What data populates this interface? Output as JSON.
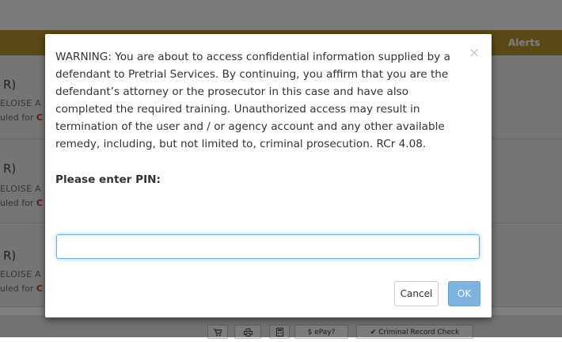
{
  "background": {
    "header": {
      "alerts_label": "Alerts"
    },
    "rows": [
      {
        "paren": "R)",
        "name": "ELOISE A",
        "sched_prefix": "uled for ",
        "sched_flag": "C"
      },
      {
        "paren": "R)",
        "name": "ELOISE A",
        "sched_prefix": "uled for ",
        "sched_flag": "C"
      },
      {
        "paren": "R)",
        "name": "ELOISE A",
        "sched_prefix": "uled for ",
        "sched_flag": "C"
      }
    ],
    "toolbar": {
      "cart_icon": "cart-icon",
      "print_icon": "print-icon",
      "calculator_icon": "calculator-icon",
      "epay_label": "$ ePay?",
      "record_check_label": "✔ Criminal Record Check"
    }
  },
  "dialog": {
    "close_symbol": "×",
    "warning_text": "WARNING: You are about to access confidential information supplied by a defendant to Pretrial Services. By continuing, you affirm that you are the defendant’s attorney or the prosecutor in this case and have also completed the required training. Unauthorized access may result in termination of the user and / or agency account and any other available remedy, including, but not limited to, criminal prosecution. RCr 4.08.",
    "pin_label": "Please enter PIN:",
    "pin_value": "",
    "cancel_label": "Cancel",
    "ok_label": "OK"
  },
  "colors": {
    "header_gold": "#b5932f",
    "ok_button": "#7fb3df",
    "input_focus": "#66afe9",
    "flag_red": "#c9302c"
  }
}
